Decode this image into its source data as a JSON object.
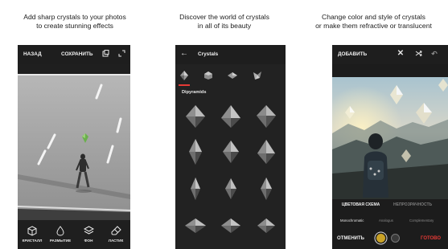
{
  "panels": [
    {
      "caption": [
        "Add sharp crystals to your photos",
        "to create stunning effects"
      ],
      "toolbar": {
        "back_label": "НАЗАД",
        "save_label": "СОХРАНИТЬ"
      },
      "tools": [
        {
          "label": "КРИСТАЛЛ",
          "icon": "cube-icon"
        },
        {
          "label": "РАЗМЫТИЕ",
          "icon": "drop-icon"
        },
        {
          "label": "ФОН",
          "icon": "layers-icon"
        },
        {
          "label": "ЛАСТИК",
          "icon": "eraser-icon"
        }
      ]
    },
    {
      "caption": [
        "Discover the world of crystals",
        "in all of its beauty"
      ],
      "toolbar": {
        "title": "Crystals"
      },
      "category": "Dipyramids"
    },
    {
      "caption": [
        "Change color and style of crystals",
        "or make them refractive or translucent"
      ],
      "toolbar": {
        "add_label": "ДОБАВИТЬ"
      },
      "tabs": [
        "ЦВЕТОВАЯ СХЕМА",
        "НЕПРОЗРАЧНОСТЬ"
      ],
      "subtabs": [
        "Monochromatic",
        "Analogus",
        "Complementary"
      ],
      "cancel_label": "ОТМЕНИТЬ",
      "done_label": "ГОТОВО",
      "swatch_colors": [
        "#c9a227",
        "#3a3a3a"
      ],
      "accent_color": "#e53935"
    }
  ]
}
